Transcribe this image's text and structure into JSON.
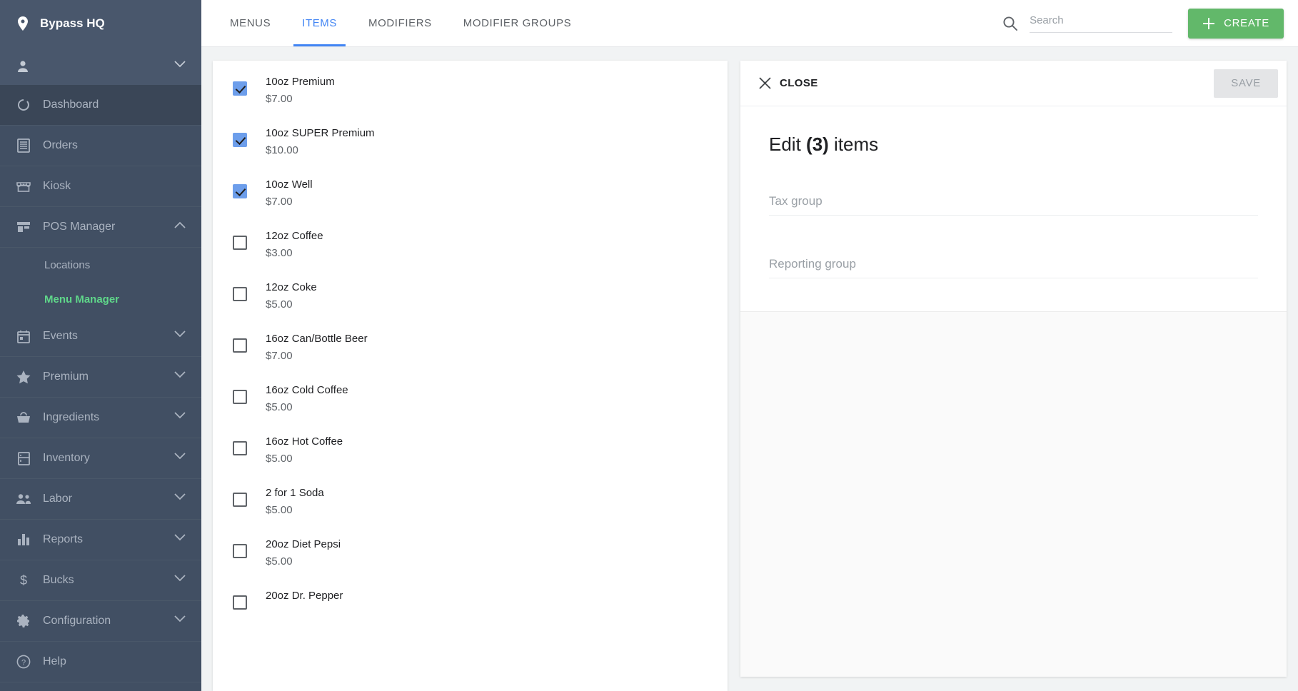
{
  "sidebar": {
    "brand": {
      "label": "Bypass HQ",
      "icon": "location-pin-icon"
    },
    "user": {
      "label": "",
      "icon": "person-icon",
      "chevron": "chevron-down-icon"
    },
    "items": [
      {
        "label": "Dashboard",
        "icon": "dashboard-icon",
        "expandable": false,
        "active": true
      },
      {
        "label": "Orders",
        "icon": "receipt-icon",
        "expandable": false,
        "active": false
      },
      {
        "label": "Kiosk",
        "icon": "kiosk-icon",
        "expandable": false,
        "active": false
      },
      {
        "label": "POS Manager",
        "icon": "store-icon",
        "expandable": true,
        "expanded": true,
        "active": false
      },
      {
        "label": "Events",
        "icon": "calendar-icon",
        "expandable": true,
        "expanded": false,
        "active": false
      },
      {
        "label": "Premium",
        "icon": "star-icon",
        "expandable": true,
        "expanded": false,
        "active": false
      },
      {
        "label": "Ingredients",
        "icon": "basket-icon",
        "expandable": true,
        "expanded": false,
        "active": false
      },
      {
        "label": "Inventory",
        "icon": "fridge-icon",
        "expandable": true,
        "expanded": false,
        "active": false
      },
      {
        "label": "Labor",
        "icon": "people-icon",
        "expandable": true,
        "expanded": false,
        "active": false
      },
      {
        "label": "Reports",
        "icon": "bar-chart-icon",
        "expandable": true,
        "expanded": false,
        "active": false
      },
      {
        "label": "Bucks",
        "icon": "dollar-icon",
        "expandable": true,
        "expanded": false,
        "active": false
      },
      {
        "label": "Configuration",
        "icon": "gear-icon",
        "expandable": true,
        "expanded": false,
        "active": false
      },
      {
        "label": "Help",
        "icon": "help-circle-icon",
        "expandable": false,
        "active": false
      }
    ],
    "submenu": [
      {
        "label": "Locations",
        "current": false
      },
      {
        "label": "Menu Manager",
        "current": true
      }
    ]
  },
  "topbar": {
    "tabs": [
      {
        "label": "MENUS",
        "active": false
      },
      {
        "label": "ITEMS",
        "active": true
      },
      {
        "label": "MODIFIERS",
        "active": false
      },
      {
        "label": "MODIFIER GROUPS",
        "active": false
      }
    ],
    "search": {
      "icon": "search-icon",
      "placeholder": "Search",
      "value": ""
    },
    "create_button": {
      "label": "CREATE",
      "icon": "plus-icon"
    }
  },
  "item_list": [
    {
      "name": "10oz Premium",
      "price": "$7.00",
      "checked": true
    },
    {
      "name": "10oz SUPER Premium",
      "price": "$10.00",
      "checked": true
    },
    {
      "name": "10oz Well",
      "price": "$7.00",
      "checked": true
    },
    {
      "name": "12oz Coffee",
      "price": "$3.00",
      "checked": false
    },
    {
      "name": "12oz Coke",
      "price": "$5.00",
      "checked": false
    },
    {
      "name": "16oz Can/Bottle Beer",
      "price": "$7.00",
      "checked": false
    },
    {
      "name": "16oz Cold Coffee",
      "price": "$5.00",
      "checked": false
    },
    {
      "name": "16oz Hot Coffee",
      "price": "$5.00",
      "checked": false
    },
    {
      "name": "2 for 1 Soda",
      "price": "$5.00",
      "checked": false
    },
    {
      "name": "20oz Diet Pepsi",
      "price": "$5.00",
      "checked": false
    },
    {
      "name": "20oz Dr. Pepper",
      "price": "",
      "checked": false
    }
  ],
  "edit_panel": {
    "close_label": "CLOSE",
    "close_icon": "close-x-icon",
    "save_label": "SAVE",
    "title_prefix": "Edit ",
    "title_count": "(3)",
    "title_suffix": " items",
    "fields": [
      {
        "placeholder": "Tax group",
        "value": ""
      },
      {
        "placeholder": "Reporting group",
        "value": ""
      }
    ]
  },
  "colors": {
    "sidebar_bg": "#414f63",
    "sidebar_header_bg": "#49576c",
    "accent_blue": "#4285f4",
    "checkbox_blue": "#6d9eeb",
    "create_green": "#62b86a",
    "submenu_green": "#5fd78a"
  }
}
